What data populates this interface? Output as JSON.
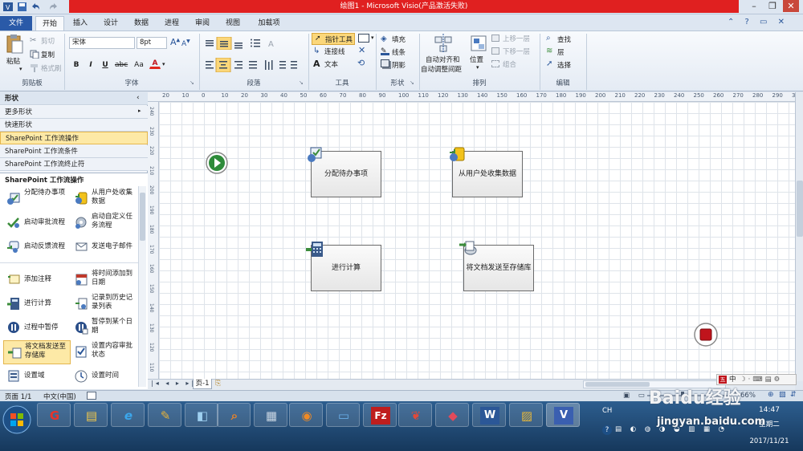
{
  "window": {
    "title": "绘图1 - Microsoft Visio(产品激活失败)",
    "quick_access": [
      "save-icon",
      "undo-icon",
      "redo-icon"
    ],
    "controls": [
      "minimize",
      "restore",
      "close"
    ]
  },
  "tabs": {
    "file": "文件",
    "items": [
      "开始",
      "插入",
      "设计",
      "数据",
      "进程",
      "审阅",
      "视图",
      "加载项"
    ],
    "active": "开始"
  },
  "ribbon": {
    "clipboard": {
      "paste": "粘贴",
      "cut": "剪切",
      "copy": "复制",
      "format_painter": "格式刷",
      "group": "剪贴板"
    },
    "font": {
      "family": "宋体",
      "size": "8pt",
      "bold": "B",
      "italic": "I",
      "underline": "U",
      "strike": "abc",
      "case": "Aa",
      "color": "A",
      "group": "字体"
    },
    "paragraph": {
      "group": "段落"
    },
    "tools": {
      "pointer": "指针工具",
      "connector": "连接线",
      "text": "文本",
      "group": "工具"
    },
    "shape": {
      "fill": "填充",
      "line": "线条",
      "shadow": "阴影",
      "group": "形状"
    },
    "arrange": {
      "auto_align_line1": "自动对齐和",
      "auto_align_line2": "自动调整间距",
      "position": "位置",
      "bring_forward": "上移一层",
      "send_backward": "下移一层",
      "group_btn": "组合",
      "group": "排列"
    },
    "edit": {
      "find": "查找",
      "layers": "层",
      "select": "选择",
      "group": "编辑"
    }
  },
  "shapes_pane": {
    "title": "形状",
    "rows": [
      "更多形状",
      "快速形状",
      "SharePoint 工作流操作",
      "SharePoint 工作流条件",
      "SharePoint 工作流终止符"
    ],
    "selected_row": "SharePoint 工作流操作",
    "stencil_title": "SharePoint 工作流操作",
    "stencils": [
      [
        "分配待办事项",
        "从用户处收集数据"
      ],
      [
        "启动审批流程",
        "启动自定义任务流程"
      ],
      [
        "启动反馈流程",
        "发送电子邮件"
      ],
      [
        "添加注释",
        "将时间添加到日期"
      ],
      [
        "进行计算",
        "记录到历史记录列表"
      ],
      [
        "过程中暂停",
        "暂停到某个日期"
      ],
      [
        "将文档发送至存储库",
        "设置内容审批状态"
      ],
      [
        "设置域",
        "设置时间"
      ]
    ],
    "selected_stencil": "将文档发送至存储库"
  },
  "rulers": {
    "top": [
      "20",
      "10",
      "0",
      "10",
      "20",
      "30",
      "40",
      "50",
      "60",
      "70",
      "80",
      "90",
      "100",
      "110",
      "120",
      "130",
      "140",
      "150",
      "160",
      "170",
      "180",
      "190",
      "200",
      "210",
      "220",
      "230",
      "240",
      "250",
      "260",
      "270",
      "280",
      "290",
      "300"
    ],
    "left": [
      "240",
      "230",
      "220",
      "210",
      "200",
      "190",
      "180",
      "170",
      "160",
      "150",
      "140",
      "130",
      "120",
      "110"
    ]
  },
  "canvas": {
    "shapes": {
      "assign": "分配待办事项",
      "collect": "从用户处收集数据",
      "calc": "进行计算",
      "send": "将文档发送至存储库"
    }
  },
  "pagebar": {
    "page_tab": "页-1"
  },
  "status": {
    "page": "页面 1/1",
    "language": "中文(中国)",
    "zoom_percent": "66%"
  },
  "ime": {
    "lang": "中",
    "badge": "五"
  },
  "taskbar": {
    "time": "14:47",
    "weekday": "星期二",
    "date": "2017/11/21",
    "lang": "CH",
    "watermark_site": "jingyan.baidu.com",
    "watermark_text": "Baidu经验"
  },
  "colors": {
    "title_bar_red": "#e02020",
    "file_tab": "#2a5aa8",
    "selection": "#fde9a6",
    "start_green": "#2e8b3a",
    "end_red": "#c0141c"
  }
}
